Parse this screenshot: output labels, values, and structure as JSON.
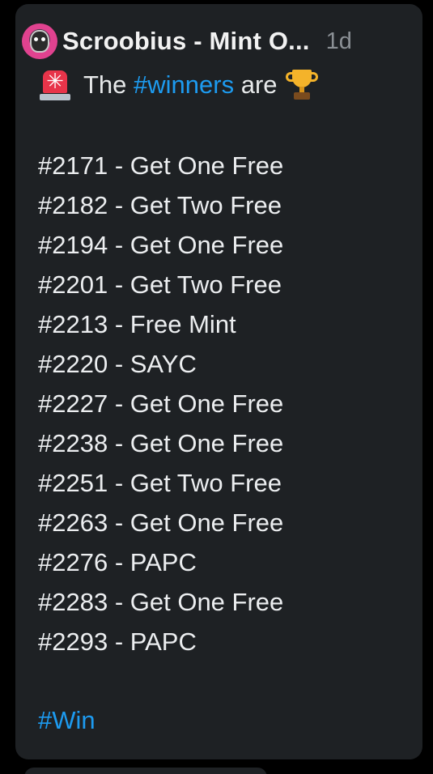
{
  "post": {
    "author": "Scroobius - Mint O...",
    "time": "1d",
    "avatar_icon": "avatar",
    "intro": {
      "icon_left": "siren-icon",
      "before": "The",
      "hashtag": "#winners",
      "after": "are",
      "icon_right": "trophy-icon"
    },
    "winners": [
      "#2171 - Get One Free",
      "#2182 - Get Two Free",
      "#2194 - Get One Free",
      "#2201 - Get Two Free",
      "#2213 - Free Mint",
      "#2220 - SAYC",
      "#2227 - Get One Free",
      "#2238 - Get One Free",
      "#2251 - Get Two Free",
      "#2263 - Get One Free",
      "#2276 - PAPC",
      "#2283 - Get One Free",
      "#2293 - PAPC"
    ],
    "footer_hashtag": "#Win"
  },
  "colors": {
    "background": "#000000",
    "card": "#1e2124",
    "text": "#eceef0",
    "muted": "#8b9095",
    "link": "#1d9bf0"
  }
}
